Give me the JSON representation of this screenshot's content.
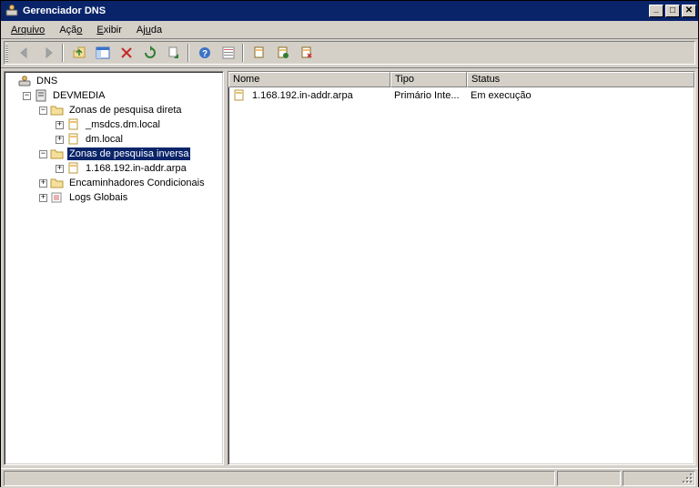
{
  "window": {
    "title": "Gerenciador DNS",
    "minimize": "_",
    "maximize": "□",
    "close": "×"
  },
  "menu": {
    "arquivo": "Arquivo",
    "acao": "Ação",
    "exibir": "Exibir",
    "ajuda": "Ajuda"
  },
  "tree": {
    "root": "DNS",
    "server": "DEVMEDIA",
    "fwd_zones": "Zonas de pesquisa direta",
    "fwd_a": "_msdcs.dm.local",
    "fwd_b": "dm.local",
    "rev_zones": "Zonas de pesquisa inversa",
    "rev_a": "1.168.192.in-addr.arpa",
    "cond_fwd": "Encaminhadores Condicionais",
    "logs": "Logs Globais"
  },
  "list": {
    "columns": {
      "name": "Nome",
      "type": "Tipo",
      "status": "Status"
    },
    "col_widths": {
      "name": 178,
      "type": 84,
      "status": 240
    },
    "rows": [
      {
        "name": "1.168.192.in-addr.arpa",
        "type": "Primário Inte...",
        "status": "Em execução"
      }
    ]
  }
}
